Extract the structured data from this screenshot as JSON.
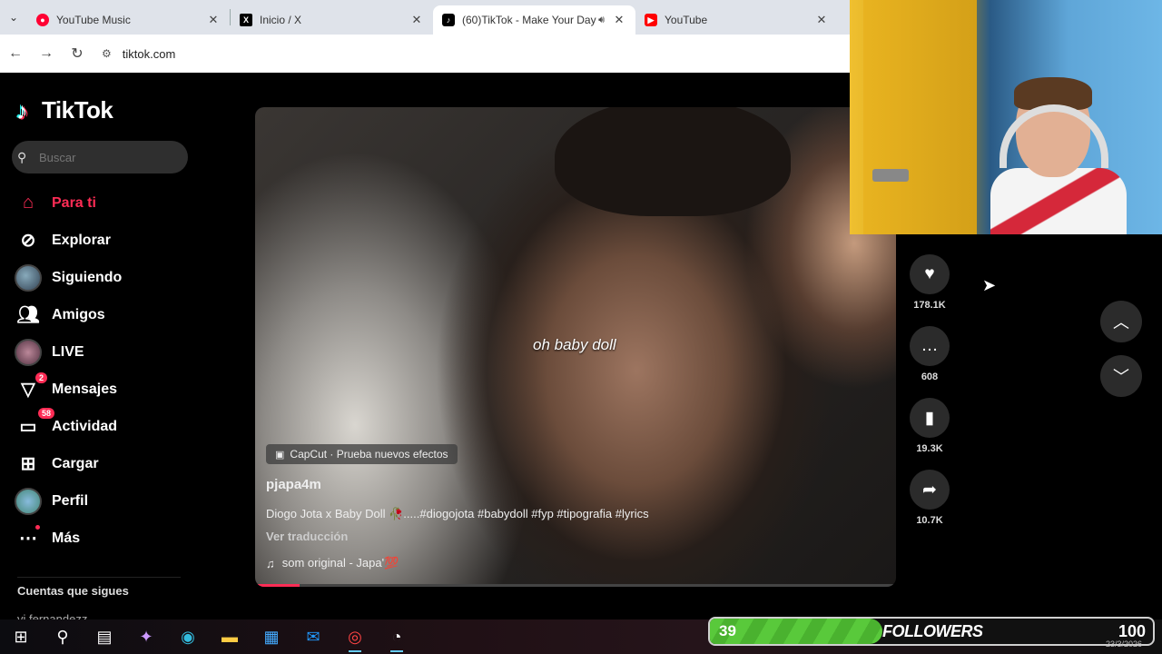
{
  "browser": {
    "tabs": [
      {
        "title": "YouTube Music",
        "icon": "youtube-music-icon",
        "color": "#ff0033",
        "active": false
      },
      {
        "title": "Inicio / X",
        "icon": "x-icon",
        "color": "#000000",
        "active": false
      },
      {
        "title": "(60)TikTok - Make Your Day",
        "icon": "tiktok-icon",
        "color": "#000000",
        "active": true
      },
      {
        "title": "YouTube",
        "icon": "youtube-icon",
        "color": "#ff0000",
        "active": false
      }
    ],
    "url": "tiktok.com"
  },
  "tiktok": {
    "logo_text": "TikTok",
    "search_placeholder": "Buscar",
    "nav": [
      {
        "label": "Para ti",
        "icon": "home-icon",
        "active": true
      },
      {
        "label": "Explorar",
        "icon": "compass-icon"
      },
      {
        "label": "Siguiendo",
        "icon": "following-avatar-icon"
      },
      {
        "label": "Amigos",
        "icon": "friends-icon"
      },
      {
        "label": "LIVE",
        "icon": "live-avatar-icon"
      },
      {
        "label": "Mensajes",
        "icon": "messages-icon",
        "badge": "2"
      },
      {
        "label": "Actividad",
        "icon": "activity-icon",
        "badge": "58"
      },
      {
        "label": "Cargar",
        "icon": "upload-icon"
      },
      {
        "label": "Perfil",
        "icon": "profile-avatar-icon"
      },
      {
        "label": "Más",
        "icon": "more-icon"
      }
    ],
    "following_section_title": "Cuentas que sigues",
    "following_first_account": "vi fernandezz",
    "accent_color": "#fe2c55"
  },
  "video": {
    "caption_overlay": "oh baby doll",
    "effect_tag": "CapCut · Prueba nuevos efectos",
    "author": "pjapa4m",
    "description": "Diogo Jota x Baby Doll 🥀.....#diogojota #babydoll #fyp #tipografia #lyrics",
    "translate_label": "Ver traducción",
    "music": "som original - Japa'💯",
    "progress": 0.07
  },
  "actions": {
    "likes": "178.1K",
    "comments": "608",
    "saves": "19.3K",
    "shares": "10.7K"
  },
  "overlay": {
    "followers_current": "39",
    "followers_label": "FOLLOWERS",
    "followers_goal": "100",
    "followers_progress": 0.39,
    "date": "23/3/2026"
  }
}
